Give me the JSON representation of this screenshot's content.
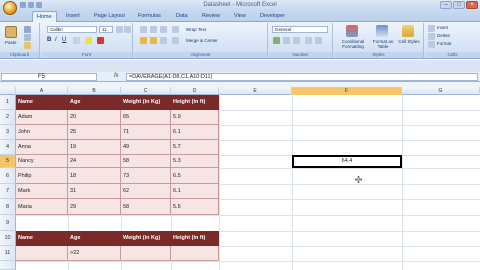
{
  "window": {
    "title": "Datasheet - Microsoft Excel",
    "controls": {
      "minimize": "–",
      "maximize": "□",
      "close": "×"
    }
  },
  "ribbon": {
    "tabs": [
      "Home",
      "Insert",
      "Page Layout",
      "Formulas",
      "Data",
      "Review",
      "View",
      "Developer"
    ],
    "active_tab": "Home",
    "groups": {
      "clipboard": {
        "label": "Clipboard",
        "paste": "Paste"
      },
      "font": {
        "label": "Font",
        "font_name": "Calibri",
        "font_size": "11"
      },
      "alignment": {
        "label": "Alignment",
        "wrap_text": "Wrap Text",
        "merge_center": "Merge & Center"
      },
      "number": {
        "label": "Number",
        "format": "General"
      },
      "styles": {
        "label": "Styles",
        "conditional_formatting": "Conditional Formatting",
        "format_as_table": "Format as Table",
        "cell_styles": "Cell Styles"
      },
      "cells": {
        "label": "Cells",
        "insert": "Insert",
        "delete": "Delete",
        "format": "Format"
      }
    }
  },
  "formula_bar": {
    "name_box": "F5",
    "fx": "fx",
    "formula": "=DAVERAGE(A1:D8,C1,A10:D11)"
  },
  "sheet": {
    "columns": [
      "A",
      "B",
      "C",
      "D",
      "E",
      "F",
      "G"
    ],
    "rows": [
      "1",
      "2",
      "3",
      "4",
      "5",
      "6",
      "7",
      "8",
      "9",
      "10",
      "11"
    ],
    "selected_column": "F",
    "selected_row": "5",
    "table_headers": [
      "Name",
      "Age",
      "Weight (in Kg)",
      "Height (in ft)"
    ],
    "table_rows": [
      [
        "Adam",
        "20",
        "65",
        "5.9"
      ],
      [
        "John",
        "25",
        "71",
        "6.1"
      ],
      [
        "Anna",
        "19",
        "49",
        "5.7"
      ],
      [
        "Nancy",
        "24",
        "58",
        "5.3"
      ],
      [
        "Philip",
        "18",
        "73",
        "6.5"
      ],
      [
        "Mark",
        "31",
        "62",
        "6.1"
      ],
      [
        "Maria",
        "29",
        "58",
        "5.5"
      ]
    ],
    "criteria_headers": [
      "Name",
      "Age",
      "Weight (in Kg)",
      "Height (in ft)"
    ],
    "criteria_row": [
      "",
      ">22",
      "",
      ""
    ],
    "active_cell_value": "64.4"
  },
  "colors": {
    "header_fill": "#7b2a2a",
    "row_fill": "#f7e4e4"
  }
}
